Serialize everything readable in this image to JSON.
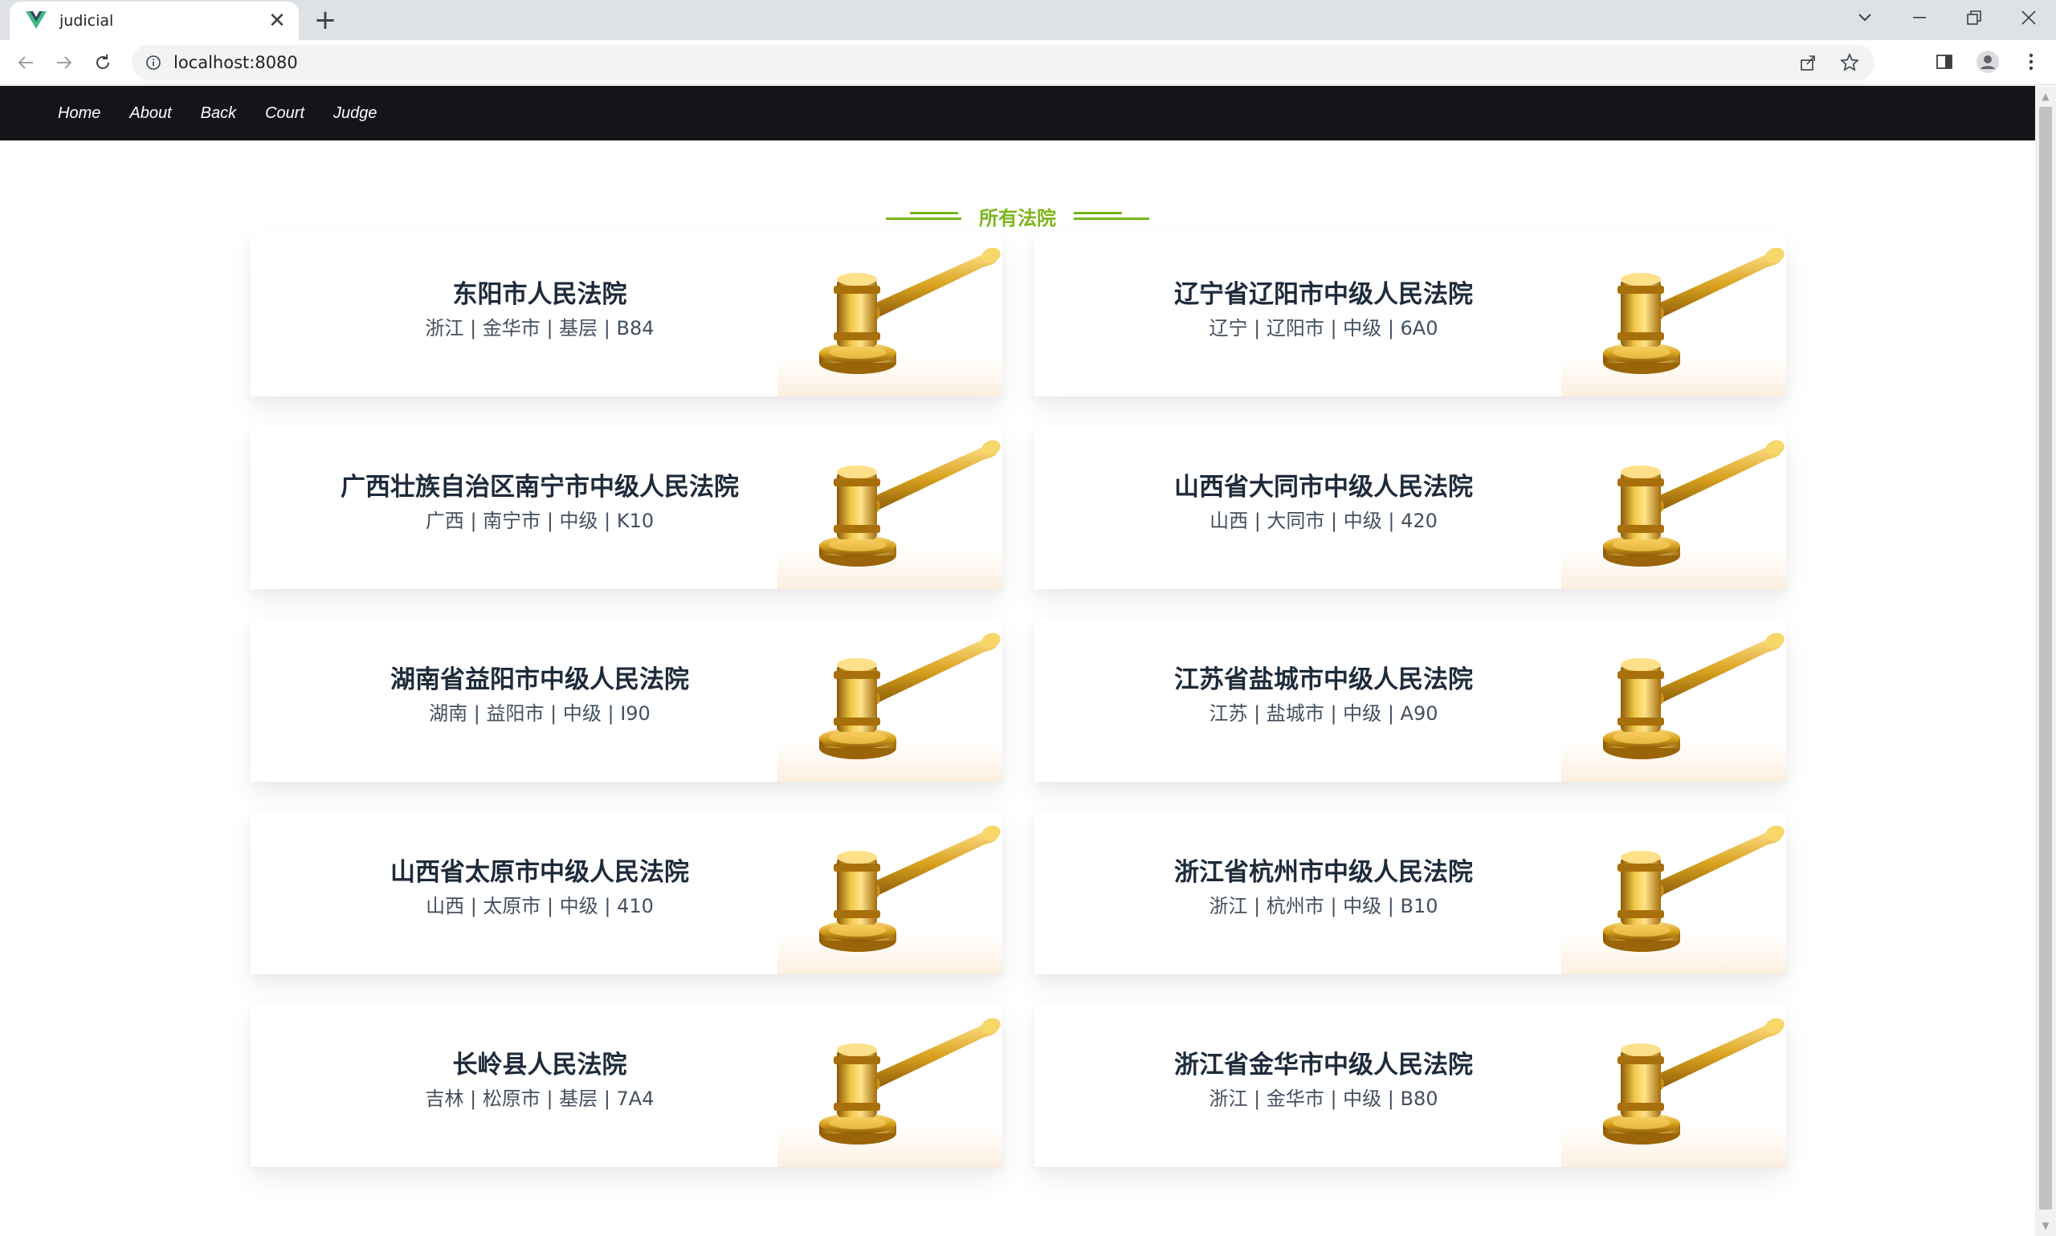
{
  "browser": {
    "tab_title": "judicial",
    "url": "localhost:8080"
  },
  "nav": {
    "items": [
      "Home",
      "About",
      "Back",
      "Court",
      "Judge"
    ]
  },
  "section_title": "所有法院",
  "courts": [
    {
      "name": "东阳市人民法院",
      "info": "浙江 | 金华市 | 基层 | B84"
    },
    {
      "name": "辽宁省辽阳市中级人民法院",
      "info": "辽宁 | 辽阳市 | 中级 | 6A0"
    },
    {
      "name": "广西壮族自治区南宁市中级人民法院",
      "info": "广西 | 南宁市 | 中级 | K10"
    },
    {
      "name": "山西省大同市中级人民法院",
      "info": "山西 | 大同市 | 中级 | 420"
    },
    {
      "name": "湖南省益阳市中级人民法院",
      "info": "湖南 | 益阳市 | 中级 | I90"
    },
    {
      "name": "江苏省盐城市中级人民法院",
      "info": "江苏 | 盐城市 | 中级 | A90"
    },
    {
      "name": "山西省太原市中级人民法院",
      "info": "山西 | 太原市 | 中级 | 410"
    },
    {
      "name": "浙江省杭州市中级人民法院",
      "info": "浙江 | 杭州市 | 中级 | B10"
    },
    {
      "name": "长岭县人民法院",
      "info": "吉林 | 松原市 | 基层 | 7A4"
    },
    {
      "name": "浙江省金华市中级人民法院",
      "info": "浙江 | 金华市 | 中级 | B80"
    }
  ],
  "colors": {
    "accent": "#7cb518",
    "nav_bg": "#141419",
    "gold": "#d9a21f"
  }
}
